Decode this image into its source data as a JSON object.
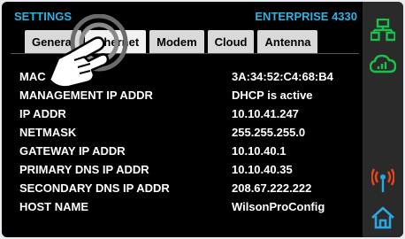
{
  "header": {
    "title": "SETTINGS",
    "model": "ENTERPRISE 4330"
  },
  "tabs": [
    {
      "label": "General"
    },
    {
      "label": "Ethernet"
    },
    {
      "label": "Modem"
    },
    {
      "label": "Cloud"
    },
    {
      "label": "Antenna"
    }
  ],
  "selected_tab": "Ethernet",
  "rows": [
    {
      "label": "MAC",
      "value": "3A:34:52:C4:68:B4"
    },
    {
      "label": "MANAGEMENT IP ADDR",
      "value": "DHCP is active"
    },
    {
      "label": "IP ADDR",
      "value": "10.10.41.247"
    },
    {
      "label": "NETMASK",
      "value": "255.255.255.0"
    },
    {
      "label": "GATEWAY IP ADDR",
      "value": "10.10.40.1"
    },
    {
      "label": "PRIMARY DNS IP ADDR",
      "value": "10.10.40.35"
    },
    {
      "label": "SECONDARY DNS IP ADDR",
      "value": "208.67.222.222"
    },
    {
      "label": "HOST NAME",
      "value": "WilsonProConfig"
    }
  ],
  "sidebar": {
    "icons": [
      "network-icon",
      "cloud-icon",
      "antenna-icon",
      "home-icon"
    ]
  },
  "colors": {
    "accent": "#2ab3e6",
    "green": "#19c24a",
    "blue": "#2aa8e0"
  }
}
